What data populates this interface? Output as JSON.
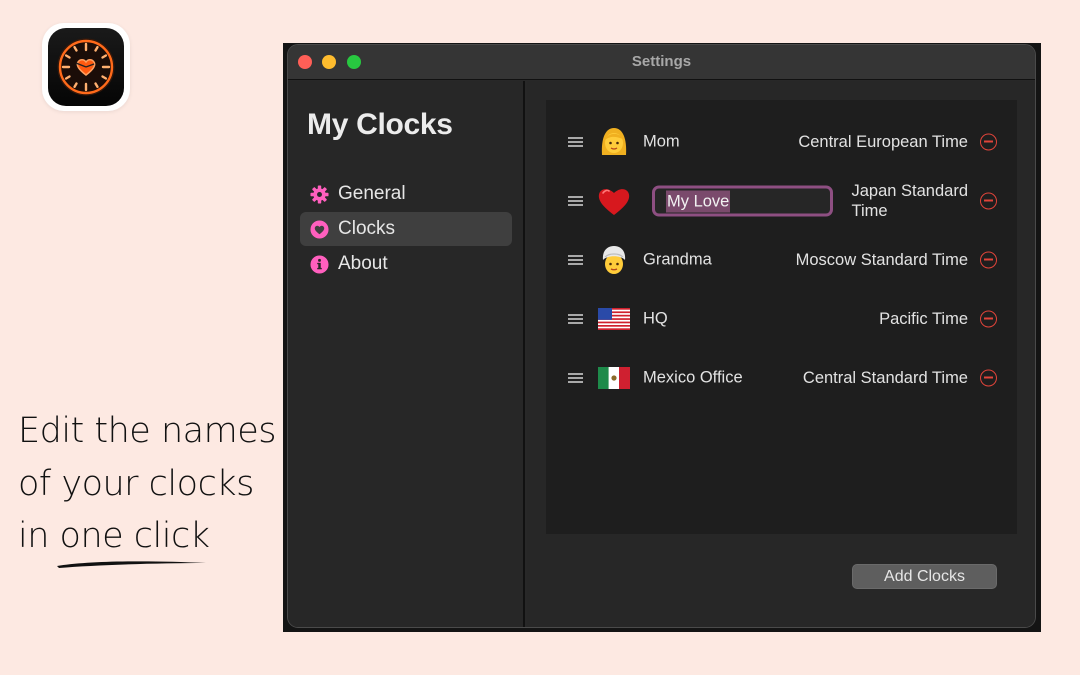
{
  "app_icon": {
    "name": "clock-heart-app-icon",
    "accent": "#ff6a1a"
  },
  "caption": {
    "lines": [
      "Edit the names",
      "of your clocks",
      "in one click"
    ]
  },
  "window": {
    "title": "Settings",
    "sidebar": {
      "title": "My Clocks",
      "items": [
        {
          "label": "General",
          "icon": "gear-icon",
          "active": false
        },
        {
          "label": "Clocks",
          "icon": "heart-circle-icon",
          "active": true
        },
        {
          "label": "About",
          "icon": "info-circle-icon",
          "active": false
        }
      ],
      "icon_color": "#ff5fbe"
    },
    "clocks": [
      {
        "name": "Mom",
        "emoji": "👩",
        "emoji_name": "woman-emoji",
        "timezone": "Central European Time",
        "editing": false
      },
      {
        "name": "My Love",
        "emoji": "❤️",
        "emoji_name": "red-heart-emoji",
        "timezone_lines": [
          "Japan Standard",
          "Time"
        ],
        "timezone": "Japan Standard Time",
        "editing": true
      },
      {
        "name": "Grandma",
        "emoji": "👳",
        "emoji_name": "person-turban-emoji",
        "timezone": "Moscow Standard Time",
        "editing": false
      },
      {
        "name": "HQ",
        "emoji": "🇺🇸",
        "emoji_name": "us-flag-emoji",
        "timezone": "Pacific Time",
        "editing": false
      },
      {
        "name": "Mexico Office",
        "emoji": "🇲🇽",
        "emoji_name": "mexico-flag-emoji",
        "timezone": "Central Standard Time",
        "editing": false
      }
    ],
    "add_button_label": "Add Clocks",
    "colors": {
      "remove": "#e0443a",
      "edit_focus": "#8e4f82"
    }
  }
}
